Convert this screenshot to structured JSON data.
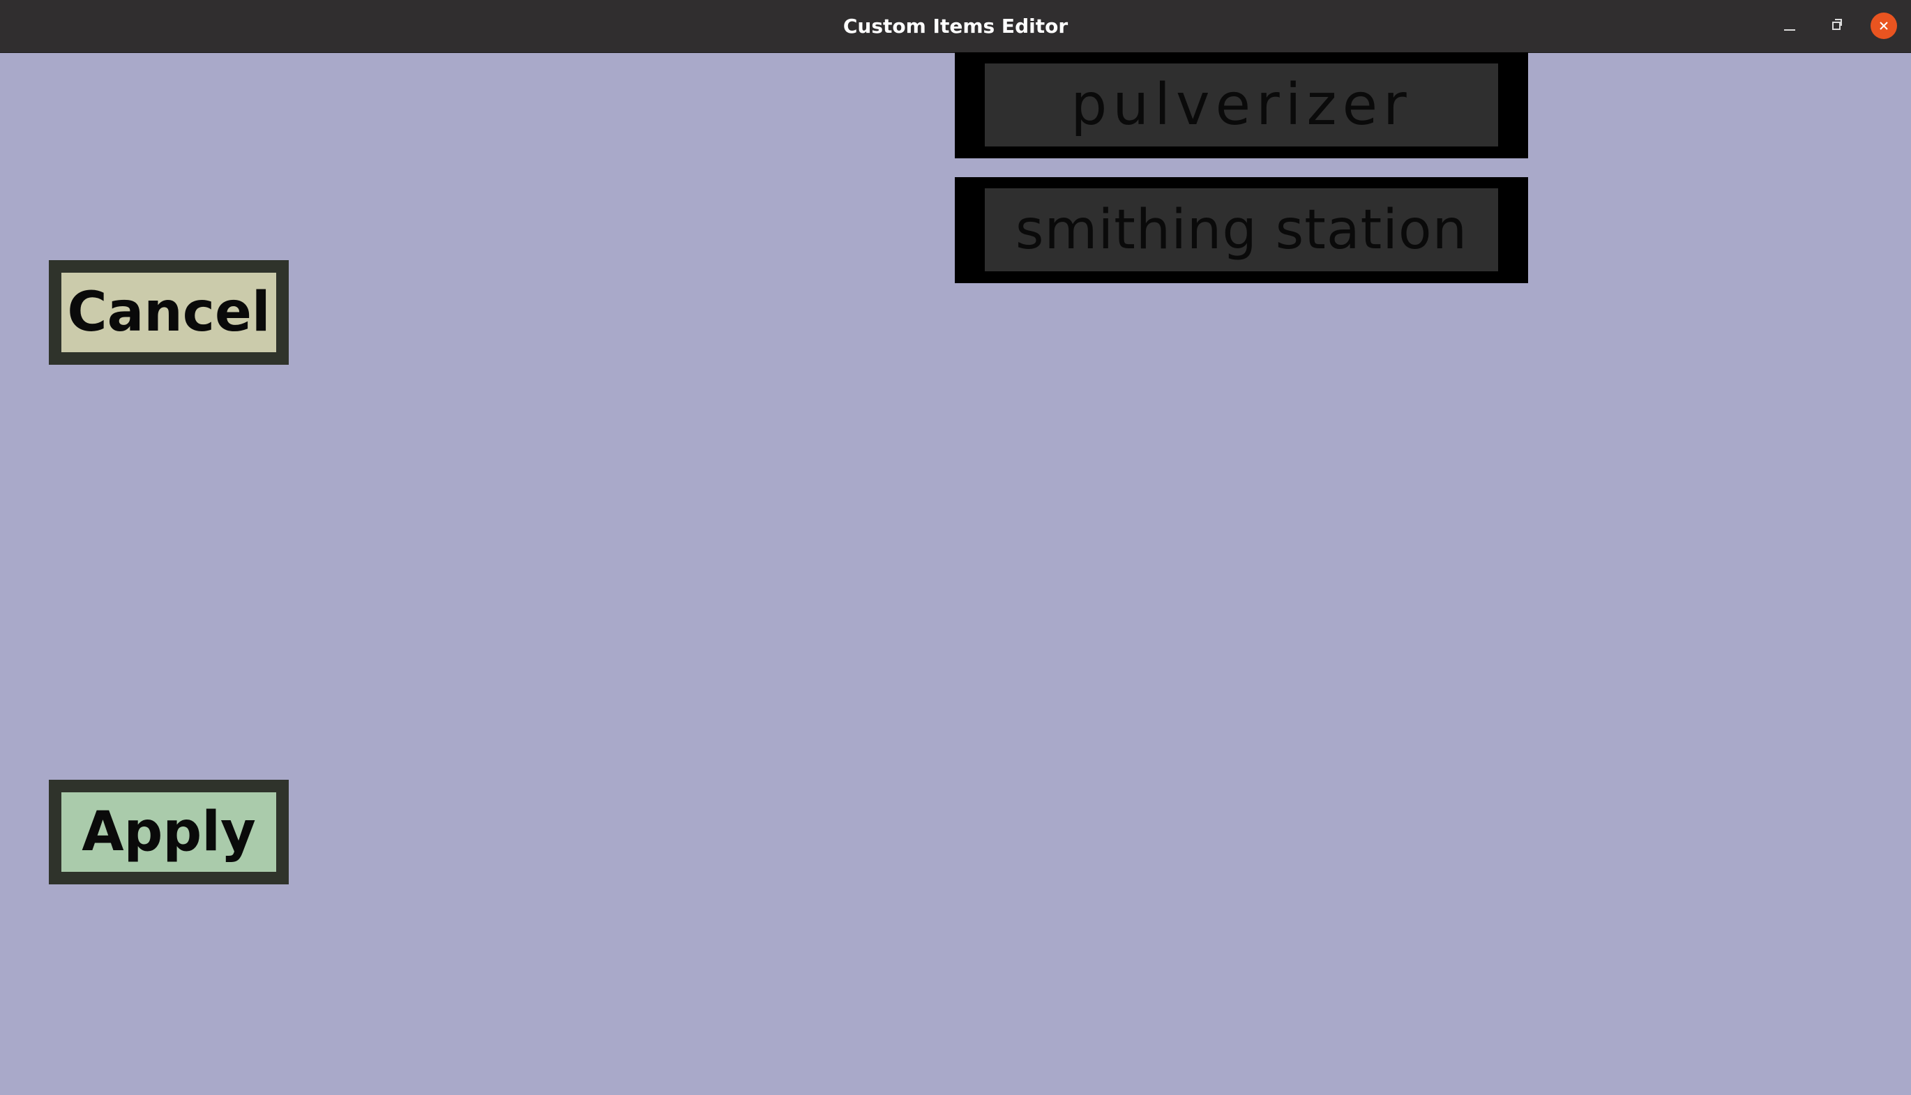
{
  "window": {
    "title": "Custom Items Editor",
    "controls": {
      "minimize_icon": "minimize-icon",
      "maximize_icon": "restore-icon",
      "close_icon": "close-icon"
    },
    "colors": {
      "background": "#a9a9c9",
      "titlebar": "#302e2f",
      "close_button": "#e95420"
    }
  },
  "items": [
    {
      "label": "pulverizer"
    },
    {
      "label": "smithing station"
    }
  ],
  "actions": {
    "cancel_label": "Cancel",
    "apply_label": "Apply",
    "cancel_color": "#cbcbab",
    "apply_color": "#aacbab"
  }
}
